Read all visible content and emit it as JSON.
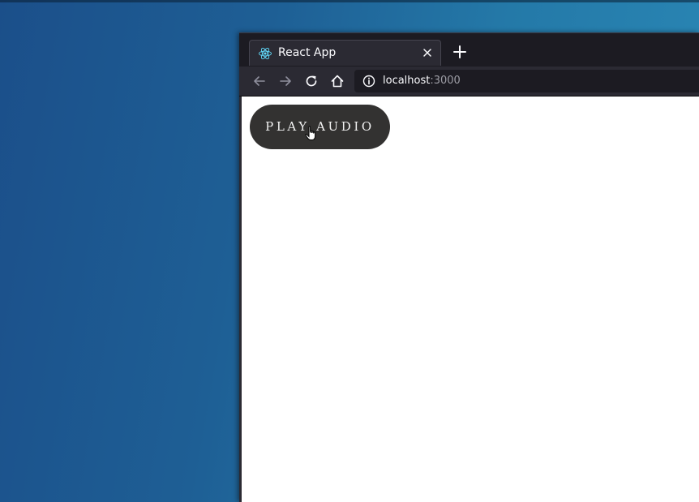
{
  "browser": {
    "tab": {
      "title": "React App",
      "favicon": "react-icon"
    },
    "nav": {
      "back": "back-arrow-icon",
      "forward": "forward-arrow-icon",
      "reload": "reload-icon",
      "home": "home-icon"
    },
    "url": {
      "host": "localhost",
      "port": ":3000"
    }
  },
  "page": {
    "play_button_label": "PLAY AUDIO"
  },
  "colors": {
    "browser_chrome": "#2b2a33",
    "tab_strip": "#1c1b22",
    "button_bg": "#333231",
    "react_blue": "#61dafb"
  }
}
